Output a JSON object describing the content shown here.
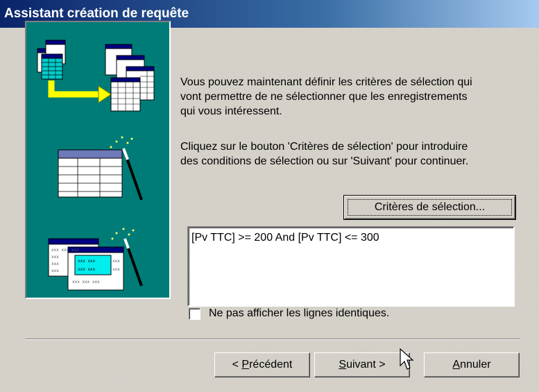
{
  "window": {
    "title": "Assistant création de requête"
  },
  "intro": {
    "paragraph1": [
      "Vous pouvez maintenant définir les critères de sélection qui",
      "vont permettre de ne sélectionner que les enregistrements",
      "qui vous intéressent."
    ],
    "paragraph2": [
      "Cliquez sur le bouton 'Critères de sélection' pour introduire",
      "des conditions de sélection ou sur 'Suivant' pour continuer."
    ]
  },
  "criteria_button": {
    "label": "Critères de sélection..."
  },
  "criteria_box": {
    "value": "[Pv TTC] >= 200 And [Pv TTC] <= 300"
  },
  "distinct_option": {
    "label": "Ne pas afficher les lignes identiques.",
    "checked": false
  },
  "buttons": {
    "previous": {
      "prefix": "< ",
      "mnemonic": "P",
      "rest": "récédent"
    },
    "next": {
      "mnemonic": "S",
      "rest": "uivant",
      "suffix": " >"
    },
    "cancel": {
      "mnemonic": "A",
      "rest": "nnuler"
    }
  },
  "colors": {
    "titlebar_start": "#0a246a",
    "titlebar_end": "#a6caf0",
    "art_background": "#007c78",
    "dialog_face": "#d4d0c8"
  },
  "icons": [
    "tables-transfer-icon",
    "table-wand-icon",
    "selected-table-wand-icon",
    "mouse-pointer-icon"
  ]
}
